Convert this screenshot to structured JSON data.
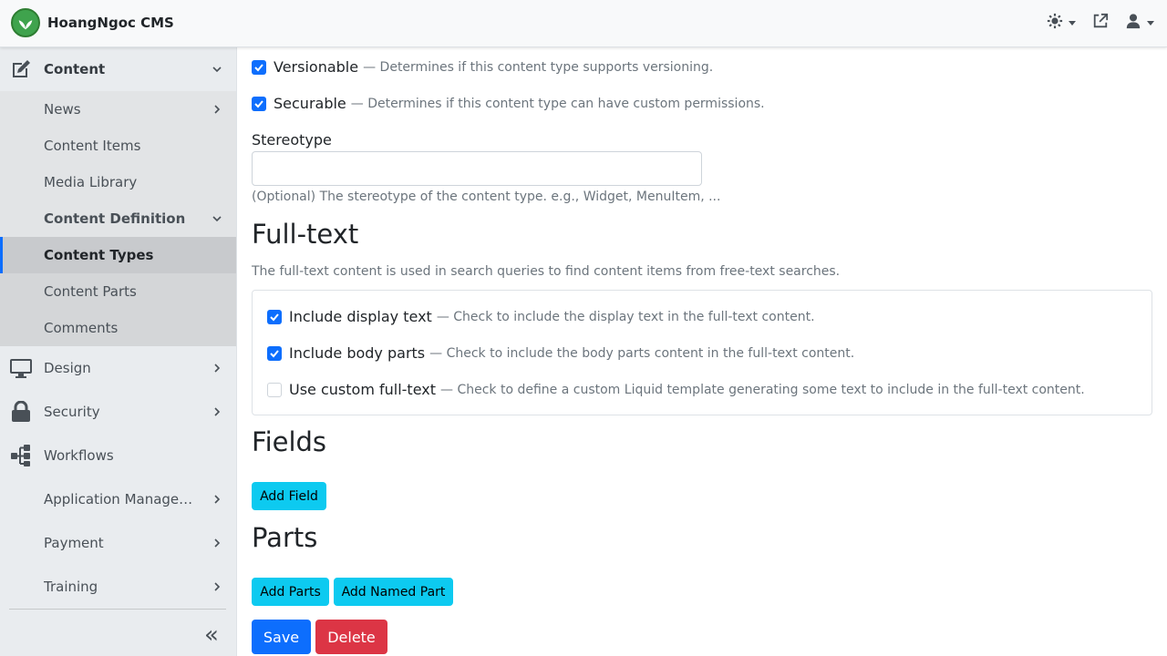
{
  "app": {
    "name": "HoangNgoc CMS",
    "colors": {
      "accent": "#0d6efd",
      "info": "#0dcaf0",
      "danger": "#dc3545",
      "brand": "#3fa34d"
    }
  },
  "topbar": {
    "actions": [
      {
        "icon": "theme-icon",
        "has_dropdown": true
      },
      {
        "icon": "external-link-icon",
        "has_dropdown": false
      },
      {
        "icon": "user-icon",
        "has_dropdown": true
      }
    ]
  },
  "sidebar": {
    "items": [
      {
        "label": "Content",
        "icon": "edit-icon",
        "expanded": true
      },
      {
        "label": "News"
      },
      {
        "label": "Content Items"
      },
      {
        "label": "Media Library"
      },
      {
        "label": "Content Definition",
        "expanded": true
      },
      {
        "label": "Content Types",
        "active": true
      },
      {
        "label": "Content Parts"
      },
      {
        "label": "Comments"
      },
      {
        "label": "Design",
        "icon": "monitor-icon"
      },
      {
        "label": "Security",
        "icon": "lock-icon"
      },
      {
        "label": "Workflows",
        "icon": "workflow-icon"
      },
      {
        "label": "Application Management"
      },
      {
        "label": "Payment"
      },
      {
        "label": "Training"
      }
    ],
    "collapse_glyph": "«"
  },
  "form": {
    "versionable": {
      "label": "Versionable",
      "hint": "— Determines if this content type supports versioning.",
      "checked": true
    },
    "securable": {
      "label": "Securable",
      "hint": "— Determines if this content type can have custom permissions.",
      "checked": true
    },
    "stereotype": {
      "label": "Stereotype",
      "value": "",
      "help": "(Optional) The stereotype of the content type. e.g., Widget, MenuItem, ..."
    }
  },
  "fulltext": {
    "heading": "Full-text",
    "description": "The full-text content is used in search queries to find content items from free-text searches.",
    "options": [
      {
        "label": "Include display text",
        "hint": "— Check to include the display text in the full-text content.",
        "checked": true
      },
      {
        "label": "Include body parts",
        "hint": "— Check to include the body parts content in the full-text content.",
        "checked": true
      },
      {
        "label": "Use custom full-text",
        "hint": "— Check to define a custom Liquid template generating some text to include in the full-text content.",
        "checked": false
      }
    ]
  },
  "fields": {
    "heading": "Fields",
    "add_label": "Add Field"
  },
  "parts": {
    "heading": "Parts",
    "add_label": "Add Parts",
    "add_named_label": "Add Named Part"
  },
  "actions": {
    "save_label": "Save",
    "delete_label": "Delete"
  }
}
